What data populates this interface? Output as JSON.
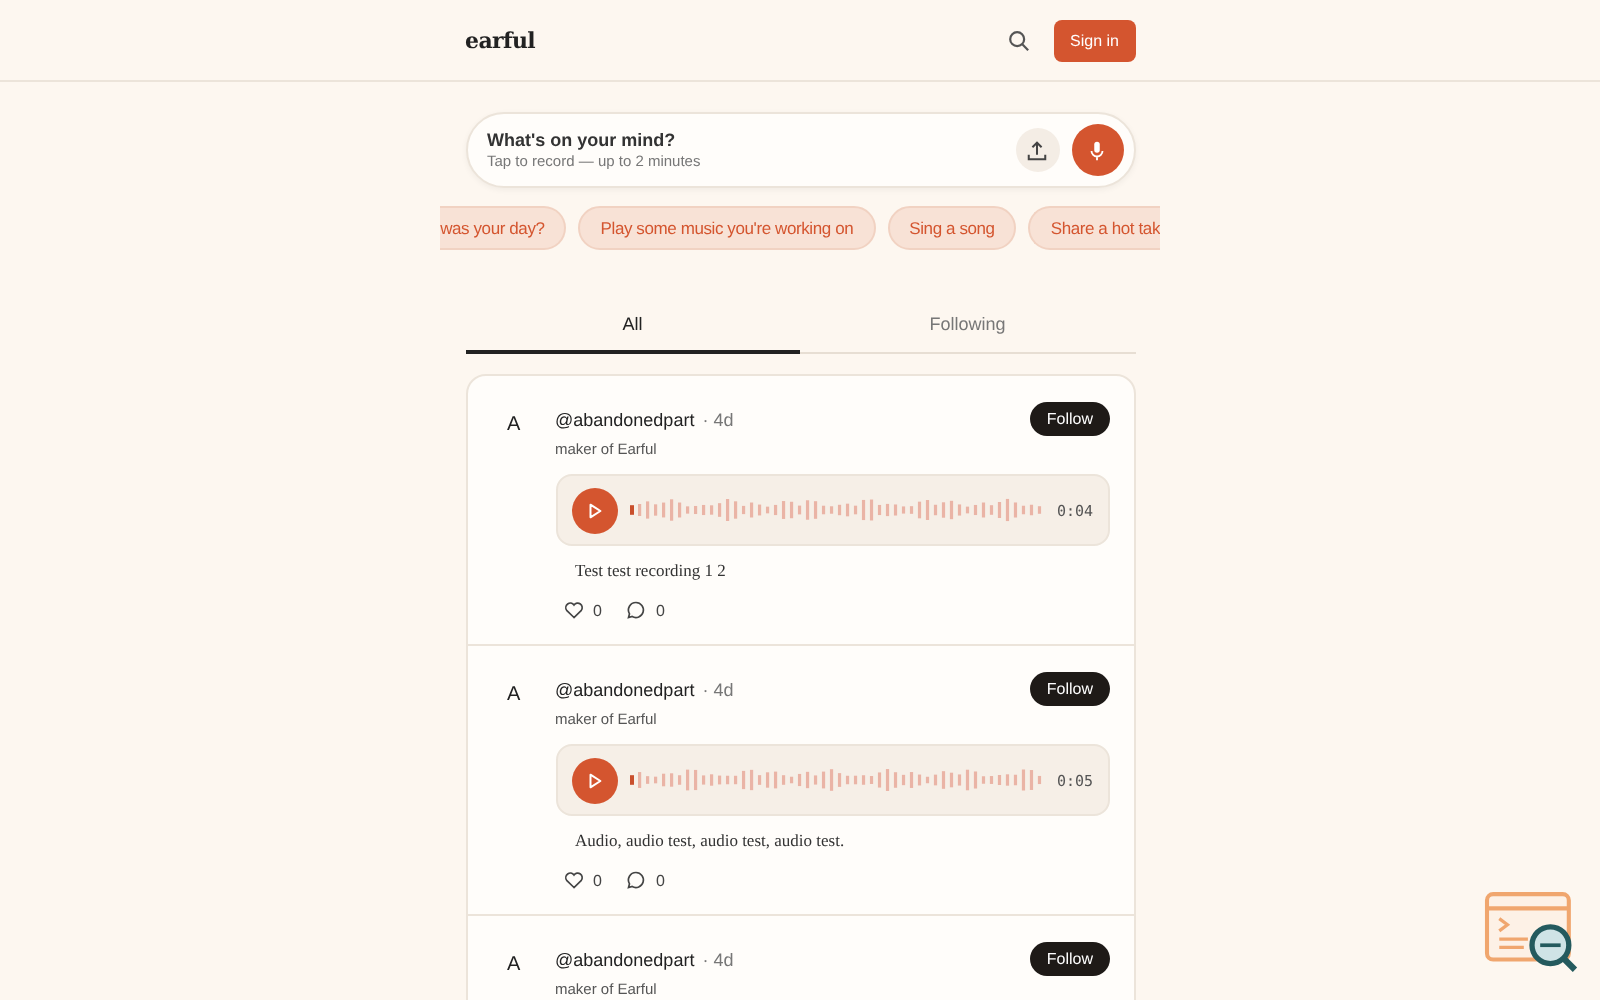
{
  "header": {
    "logo": "earful",
    "sign_in": "Sign in"
  },
  "composer": {
    "title": "What's on your mind?",
    "subtitle": "Tap to record — up to 2 minutes"
  },
  "prompts": [
    "was your day?",
    "Play some music you're working on",
    "Sing a song",
    "Share a hot tak"
  ],
  "tabs": [
    {
      "label": "All",
      "selected": true
    },
    {
      "label": "Following",
      "selected": false
    }
  ],
  "posts": [
    {
      "avatar": "A",
      "handle": "@abandonedpart",
      "age": "· 4d",
      "bio": "maker of Earful",
      "follow": "Follow",
      "duration": "0:04",
      "caption": "Test test recording 1 2",
      "likes": "0",
      "comments": "0"
    },
    {
      "avatar": "A",
      "handle": "@abandonedpart",
      "age": "· 4d",
      "bio": "maker of Earful",
      "follow": "Follow",
      "duration": "0:05",
      "caption": "Audio, audio test, audio test, audio test.",
      "likes": "0",
      "comments": "0"
    },
    {
      "avatar": "A",
      "handle": "@abandonedpart",
      "age": "· 4d",
      "bio": "maker of Earful",
      "follow": "Follow"
    }
  ]
}
